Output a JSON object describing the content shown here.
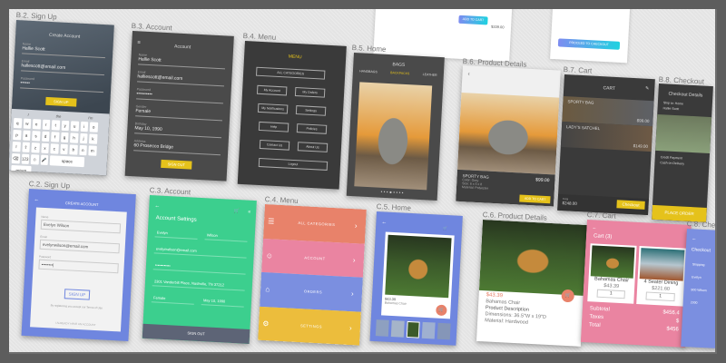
{
  "colors": {
    "yellow": "#e5c21b",
    "blue": "#6f86df",
    "green": "#3ccf8e",
    "orange": "#e8826a",
    "pink": "#ea84a1",
    "menu_blue": "#7b8fe0",
    "menu_yellow": "#ecbd3c",
    "dark": "#4a4a4a"
  },
  "top_cards": {
    "add_to_cart": "ADD TO CART",
    "price": "$339.00",
    "proceed": "PROCEED TO CHECKOUT"
  },
  "b2": {
    "label": "B.2. Sign Up",
    "title": "Create Account",
    "name_k": "Name",
    "name": "Hallie Scott",
    "email_k": "Email",
    "email": "hallescott@email.com",
    "pass_k": "Password",
    "pass": "••••••",
    "button": "SIGN UP",
    "suggest": [
      "I",
      "the",
      "I'm"
    ],
    "keys": [
      "q",
      "w",
      "e",
      "r",
      "t",
      "y",
      "u",
      "i",
      "o",
      "p",
      "a",
      "s",
      "d",
      "f",
      "g",
      "h",
      "j",
      "k",
      "l",
      "⇧",
      "z",
      "x",
      "c",
      "v",
      "b",
      "n",
      "m",
      "⌫",
      "123",
      "☺",
      "🎤",
      "space",
      "return"
    ]
  },
  "b3": {
    "label": "B.3. Account",
    "title": "Account",
    "fields": [
      {
        "k": "Name",
        "v": "Hallie Scott"
      },
      {
        "k": "Email",
        "v": "halliescott@email.com"
      },
      {
        "k": "Password",
        "v": "••••••••••"
      },
      {
        "k": "Gender",
        "v": "Female"
      },
      {
        "k": "Birthday",
        "v": "May 10, 1990"
      },
      {
        "k": "Address",
        "v": "60 Prosecco Bridge"
      }
    ],
    "button": "SIGN OUT"
  },
  "b4": {
    "label": "B.4. Menu",
    "title": "MENU",
    "items": [
      "ALL CATEGORIES",
      "My Account",
      "My Orders",
      "My Notifications",
      "Settings",
      "Help",
      "Policies",
      "Contact Us",
      "About Us",
      "Logout"
    ]
  },
  "b5": {
    "label": "B.5. Home",
    "title": "BAGS",
    "tabs": [
      "HANDBAGS",
      "BACKPACKS",
      "LEATHER"
    ]
  },
  "b6": {
    "label": "B.6. Product Details",
    "name": "SPORTY BAG",
    "meta": [
      "Color: Grey",
      "Size: 6 x 5 x 8",
      "Material: Polyester"
    ],
    "price": "$99.00",
    "button": "ADD TO CART"
  },
  "b7": {
    "label": "B.7. Cart",
    "title": "CART",
    "items": [
      {
        "name": "SPORTY BAG",
        "price": "$99.00"
      },
      {
        "name": "LADY'S SATCHEL",
        "price": "$149.00"
      }
    ],
    "total_k": "Total",
    "total": "$248.00",
    "button": "Checkout"
  },
  "b8": {
    "label": "B.8. Checkout",
    "title": "Checkout Details",
    "lines": [
      "Ship to: Home",
      "Hallie Scott",
      "Credit Payment",
      "Cash on Delivery"
    ],
    "button": "PLACE ORDER"
  },
  "c2": {
    "label": "C.2. Sign Up",
    "title": "CREATE ACCOUNT",
    "name_k": "Name",
    "name": "Evelyn Wilson",
    "email_k": "Email",
    "email": "evelynwilson@email.com",
    "pass_k": "Password",
    "pass": "••••••••|",
    "button": "SIGN UP",
    "terms": "By registering you accept our Terms of Use",
    "footer": "I ALREADY HAVE AN ACCOUNT"
  },
  "c3": {
    "label": "C.3. Account",
    "title": "Account Settings",
    "first": "Evelyn",
    "last": "Wilson",
    "email": "evelynwilson@email.com",
    "pass": "••••••••••••",
    "address": "2301 Vanderbilt Place, Nashville, TN 37212",
    "gender": "Female",
    "birthday": "May 10, 1990",
    "button": "SIGN OUT"
  },
  "c4": {
    "label": "C.4. Menu",
    "items": [
      {
        "label": "ALL CATEGORIES",
        "icon": "☰"
      },
      {
        "label": "ACCOUNT",
        "icon": "☺"
      },
      {
        "label": "ORDERS",
        "icon": "⌂"
      },
      {
        "label": "SETTINGS",
        "icon": "⚙"
      }
    ]
  },
  "c5": {
    "label": "C.5. Home",
    "price": "$43.39",
    "name": "Bahamas Chair"
  },
  "c6": {
    "label": "C.6. Product Details",
    "price": "$43.39",
    "name": "Bahamas Chair",
    "desc": "Product Description",
    "dims": "Dimensions: 36.5\"W x 19\"D",
    "material": "Material: Hardwood"
  },
  "c7": {
    "label": "C.7. Cart",
    "title": "Cart (3)",
    "items": [
      {
        "name": "Bahamas Chair",
        "price": "$43.39",
        "qty": "1"
      },
      {
        "name": "4 Seater Dining",
        "price": "$221.60",
        "qty": "1"
      }
    ],
    "summary": [
      {
        "k": "Subtotal",
        "v": "$456.4"
      },
      {
        "k": "Taxes",
        "v": "$"
      },
      {
        "k": "Total",
        "v": "$456"
      }
    ]
  },
  "c8": {
    "label": "C.8. Checkout",
    "title": "Checkout",
    "lines": [
      "Shipping",
      "Evelyn",
      "900 Wilson",
      "2300"
    ]
  }
}
